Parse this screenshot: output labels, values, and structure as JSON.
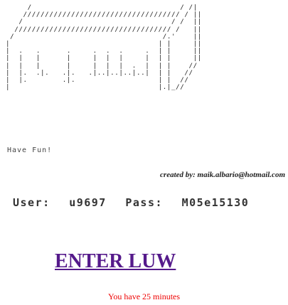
{
  "ascii_logo": "     /                                  / /|\n    //////////////////////////////////// / ||\n   /                                  / /  ||\n  //////////////////////////////////// /   ||\n /                                  /.'    ||\n|                                  | |     ||\n|  .   .      .     .  .  .     .  | |     ||\n|  |   |      |     |  |  |     |  | |     ||\n|  |   |      |     |  |  |  .  |  | |    //\n|  |.  .|.   .|.   .|..|..|..|..|  | |   //\n|  |.        .|.                   | |  //\n|                                  |.|_//",
  "tagline": "Have Fun!",
  "credit": "created by: maik.albario@hotmail.com",
  "credentials": {
    "user_label": "User:",
    "user_value": "u9697",
    "pass_label": "Pass:",
    "pass_value": "M05e15130"
  },
  "enter_link": "ENTER LUW",
  "timer_text": "You have 25 minutes",
  "colors": {
    "link": "#551a8b",
    "timer": "#ee0000"
  }
}
